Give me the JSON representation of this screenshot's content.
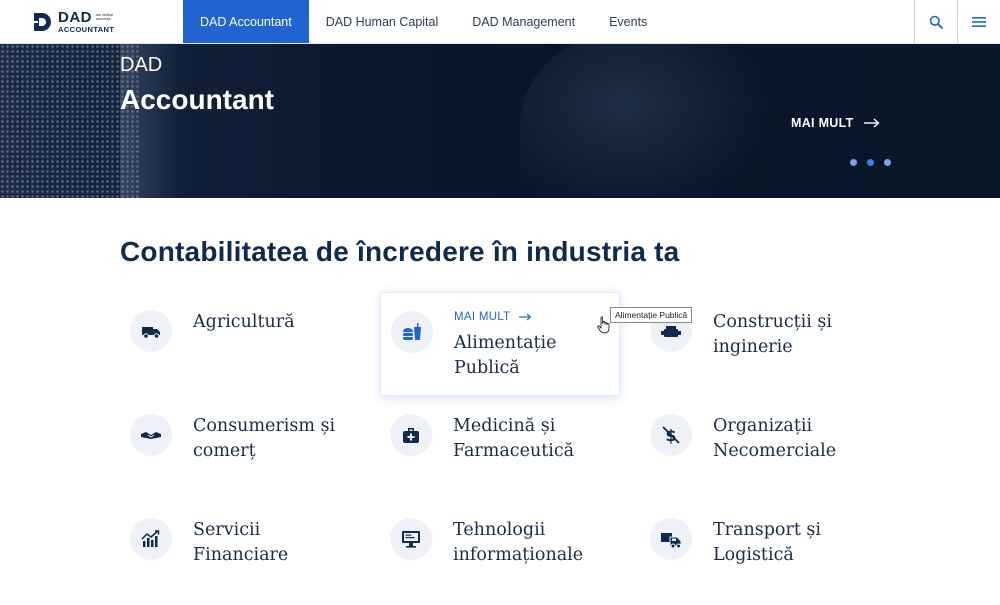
{
  "logo": {
    "brand": "DAD",
    "tagline": "we define success",
    "product": "ACCOUNTANT"
  },
  "nav": {
    "items": [
      {
        "label": "DAD Accountant",
        "active": true
      },
      {
        "label": "DAD Human Capital",
        "active": false
      },
      {
        "label": "DAD Management",
        "active": false
      },
      {
        "label": "Events",
        "active": false
      }
    ],
    "search_icon": "search-icon",
    "menu_icon": "hamburger-menu-icon"
  },
  "hero": {
    "subtitle": "DAD",
    "title": "Accountant",
    "more_label": "MAI MULT",
    "slides": 3,
    "active_slide": 2
  },
  "section": {
    "title": "Contabilitatea de încredere în industria ta",
    "more_label": "MAI MULT",
    "industries": [
      {
        "label": "Agricultură",
        "icon": "tractor-truck-icon"
      },
      {
        "label": "Alimentație Publică",
        "icon": "food-drink-icon",
        "hovered": true
      },
      {
        "label": "Construcții și inginerie",
        "icon": "engine-icon"
      },
      {
        "label": "Consumerism și comerț",
        "icon": "handshake-icon"
      },
      {
        "label": "Medicină și Farmaceutică",
        "icon": "medical-kit-icon"
      },
      {
        "label": "Organizații Necomerciale",
        "icon": "no-dollar-icon"
      },
      {
        "label": "Servicii Financiare",
        "icon": "chart-trend-icon"
      },
      {
        "label": "Tehnologii informaționale",
        "icon": "monitor-icon"
      },
      {
        "label": "Transport și Logistică",
        "icon": "truck-car-icon"
      }
    ]
  },
  "tooltip": {
    "text": "Alimentație Publică"
  },
  "colors": {
    "accent": "#1f64d0",
    "navy": "#0f2a4a",
    "icon_bg": "#eef2f8"
  }
}
